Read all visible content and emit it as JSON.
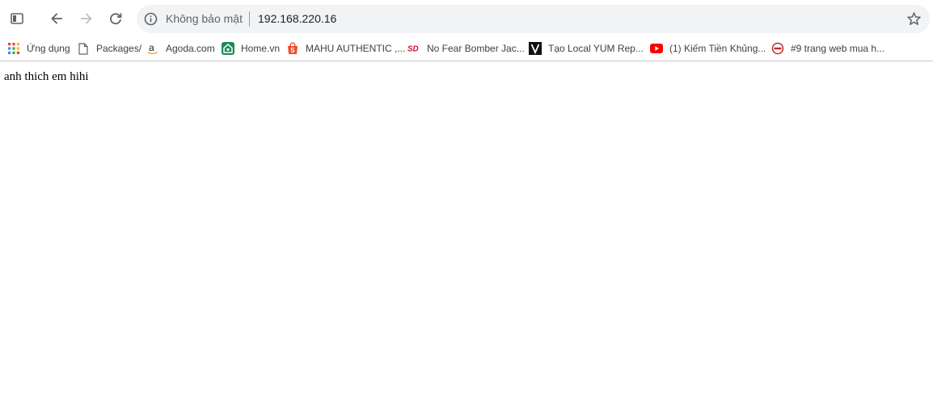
{
  "omnibox": {
    "security_label": "Không bảo mật",
    "url": "192.168.220.16"
  },
  "bookmarks": [
    {
      "label": "Ứng dụng",
      "icon": "apps-grid-icon"
    },
    {
      "label": "Packages/",
      "icon": "page-icon"
    },
    {
      "label": "Agoda.com",
      "icon": "amazon-icon"
    },
    {
      "label": "Home.vn",
      "icon": "homevn-icon"
    },
    {
      "label": "MAHU AUTHENTIC ,...",
      "icon": "shopee-icon"
    },
    {
      "label": "No Fear Bomber Jac...",
      "icon": "sd-icon"
    },
    {
      "label": "Tạo Local YUM Rep...",
      "icon": "v-icon"
    },
    {
      "label": "(1) Kiếm Tiền Khủng...",
      "icon": "youtube-icon"
    },
    {
      "label": "#9 trang web mua h...",
      "icon": "site-logo-icon"
    }
  ],
  "page": {
    "body_text": "anh thich em hihi"
  },
  "colors": {
    "omnibox_bg": "#f1f3f4",
    "icon_gray": "#5f6368",
    "youtube_red": "#ff0000",
    "shopee_orange": "#ee4d2d",
    "homevn_green": "#1e8a5a"
  }
}
